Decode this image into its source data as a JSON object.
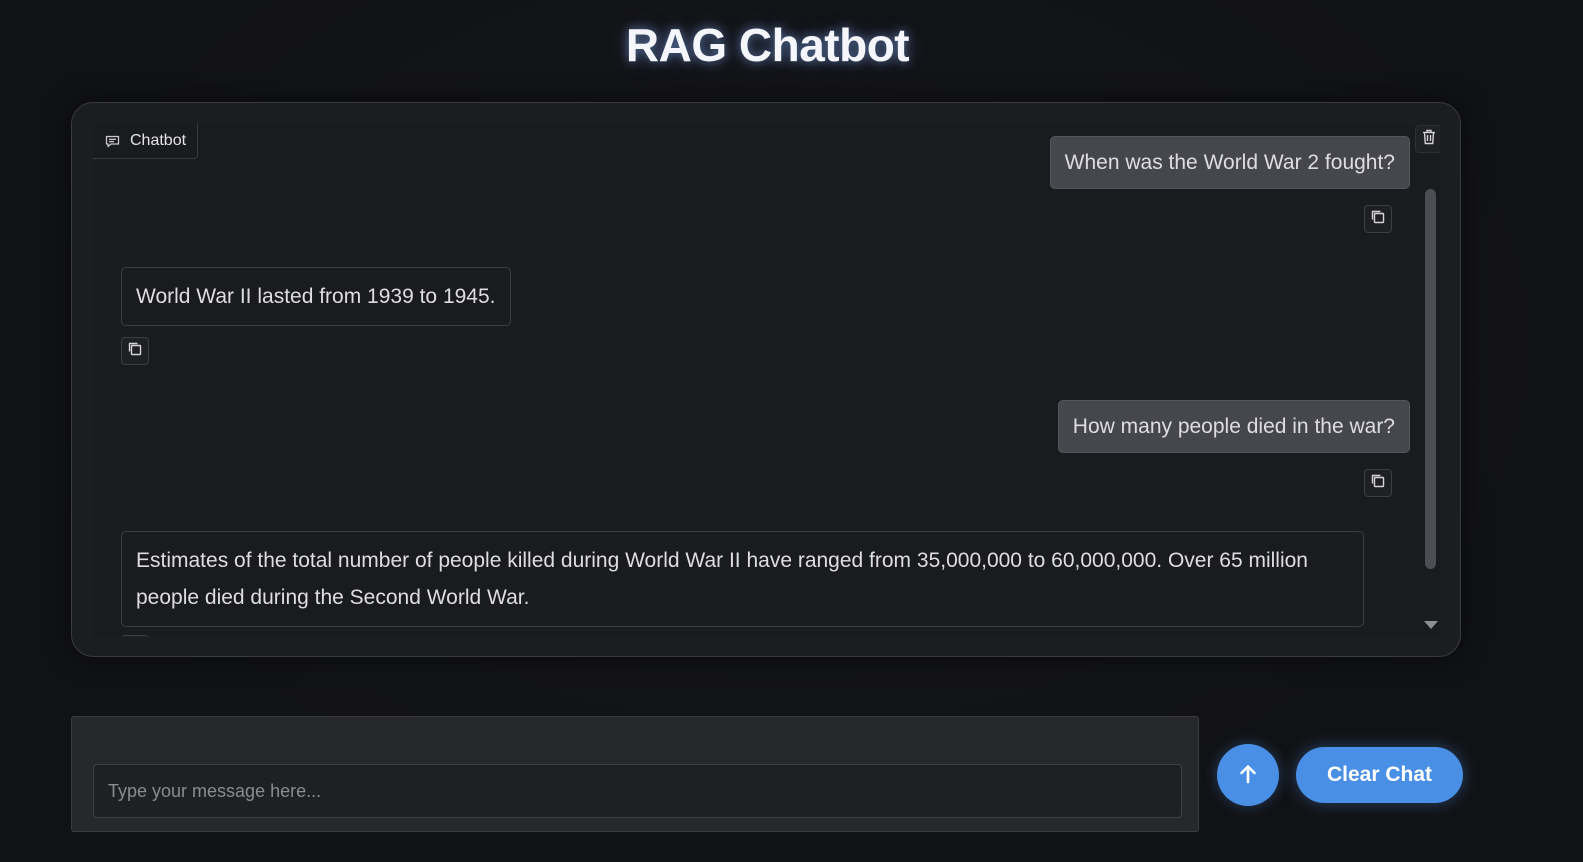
{
  "app": {
    "title": "RAG Chatbot"
  },
  "chatbot": {
    "label": "Chatbot",
    "label_icon": "chat-bubble-icon",
    "clear_icon": "trash-icon",
    "messages": [
      {
        "role": "user",
        "text": "When was the World War 2 fought?"
      },
      {
        "role": "bot",
        "text": "World War II lasted from 1939 to 1945."
      },
      {
        "role": "user",
        "text": "How many people died in the war?"
      },
      {
        "role": "bot",
        "text": "Estimates of the total number of people killed during World War II have ranged from 35,000,000 to 60,000,000. Over 65 million people died during the Second World War."
      }
    ],
    "copy_icon": "copy-icon"
  },
  "composer": {
    "placeholder": "Type your message here...",
    "value": "",
    "send_icon": "arrow-up-icon",
    "clear_label": "Clear Chat"
  },
  "colors": {
    "accent": "#4a8fe6",
    "background": "#121316",
    "user_bubble": "#46474d"
  }
}
